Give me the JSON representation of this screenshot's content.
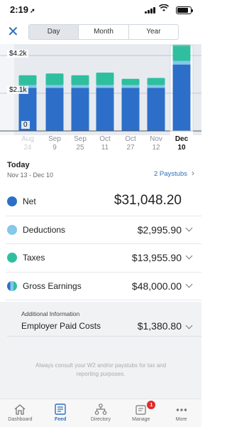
{
  "status_bar": {
    "time": "2:19",
    "location_arrow": "➚",
    "wifi_icon": "wifi-icon",
    "battery_icon": "battery-icon"
  },
  "header": {
    "close_icon": "close-icon",
    "segments": [
      {
        "label": "Day",
        "active": true
      },
      {
        "label": "Month",
        "active": false
      },
      {
        "label": "Year",
        "active": false
      }
    ]
  },
  "chart_data": {
    "type": "bar",
    "stacked": true,
    "y_ticks": [
      "$4.2k",
      "$2.1k",
      "0"
    ],
    "ylim": [
      0,
      4200
    ],
    "categories": [
      {
        "month": "Aug",
        "day": "24"
      },
      {
        "month": "Sep",
        "day": "9"
      },
      {
        "month": "Sep",
        "day": "25"
      },
      {
        "month": "Oct",
        "day": "11"
      },
      {
        "month": "Oct",
        "day": "27"
      },
      {
        "month": "Nov",
        "day": "12"
      },
      {
        "month": "Dec",
        "day": "10"
      }
    ],
    "selected_index": 6,
    "series": [
      {
        "values": [
          2400,
          2400,
          2400,
          2400,
          2400,
          2400,
          3700
        ]
      },
      {
        "values": [
          150,
          150,
          150,
          150,
          150,
          150,
          200
        ]
      },
      {
        "values": [
          550,
          650,
          550,
          700,
          350,
          400,
          900
        ]
      }
    ],
    "colors": {
      "net": "#2d6fc8",
      "deductions": "#84c8ea",
      "taxes": "#2fbf9f",
      "grid": "#9aa3ad",
      "selected_bg": "#ffffff",
      "plot_bg": "#e7ebf0"
    }
  },
  "today": {
    "title": "Today",
    "range": "Nov 13 - Dec 10",
    "paystubs_link": "2 Paystubs"
  },
  "rows": [
    {
      "label": "Net",
      "value": "$31,048.20",
      "color": "#2d6fc8",
      "big": true,
      "chevron": false
    },
    {
      "label": "Deductions",
      "value": "$2,995.90",
      "color": "#84c8ea",
      "big": false,
      "chevron": true
    },
    {
      "label": "Taxes",
      "value": "$13,955.90",
      "color": "#2fbf9f",
      "big": false,
      "chevron": true
    },
    {
      "label": "Gross Earnings",
      "value": "$48,000.00",
      "color": "split",
      "big": false,
      "chevron": true
    }
  ],
  "additional": {
    "heading": "Additional Information",
    "label": "Employer Paid Costs",
    "value": "$1,380.80",
    "note": "Always consult your W2 and/or paystubs for tax and reporting purposes."
  },
  "tabs": [
    {
      "label": "Dashboard",
      "icon": "home-icon",
      "active": false
    },
    {
      "label": "Feed",
      "icon": "feed-icon",
      "active": true
    },
    {
      "label": "Directory",
      "icon": "directory-icon",
      "active": false
    },
    {
      "label": "Manage",
      "icon": "manage-icon",
      "active": false,
      "badge": "1"
    },
    {
      "label": "More",
      "icon": "more-icon",
      "active": false
    }
  ],
  "accent": "#2f6fbd"
}
